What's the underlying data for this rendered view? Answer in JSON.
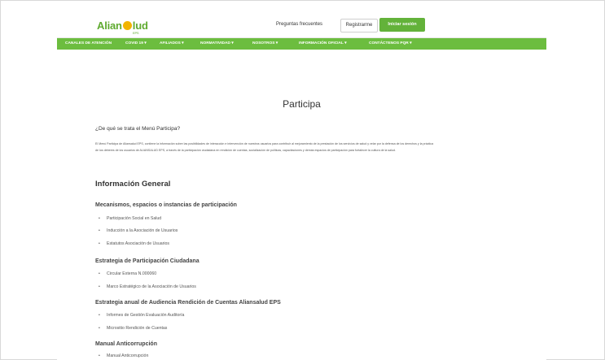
{
  "header": {
    "logo_text_a": "Alian",
    "logo_text_b": "lud",
    "logo_small": "EPS",
    "faq_link": "Preguntas frecuentes",
    "register_button": "Registrarme",
    "login_button": "Iniciar sesión"
  },
  "nav": {
    "items": [
      "CANALES DE ATENCIÓN",
      "COVID 19 ▾",
      "AFILIADOS ▾",
      "NORMATIVIDAD ▾",
      "NOSOTROS ▾",
      "INFORMACIÓN OFICIAL ▾",
      "CONTÁCTENOS PQR ▾"
    ]
  },
  "main": {
    "title": "Participa",
    "question": "¿De qué se trata el Menú Participa?",
    "paragraph": "El Menú Participa de Aliansalud EPS, contiene la información sobre las posibilidades de interacción e intervención de nuestros usuarios para contribuir al mejoramiento de la prestación de los servicios de salud y velar por la defensa de los derechos y la práctica de los deberes de los usuarios de ALIANSALUD EPS, a través de la participación ciudadana en rendición de cuentas, socialización de políticas, capacitaciones y demás espacios de participación para fortalecer la cultura de la salud.",
    "general_heading": "Información General",
    "sections": [
      {
        "heading": "Mecanismos, espacios o instancias de participación",
        "items": [
          "Participación Social en Salud",
          "Inducción a la Asociación de Usuarios",
          "Estatutos Asociación de Usuarios"
        ]
      },
      {
        "heading": "Estrategia de Participación Ciudadana",
        "items": [
          "Circular Externa N.000060",
          "Marco Estratégico de la Asociación de Usuarios"
        ]
      },
      {
        "heading": "Estrategia anual de Audiencia Rendición de Cuentas Aliansalud EPS",
        "items": [
          "Informes de Gestión Evaluación Auditoría",
          "Micrositio Rendición de Cuentas"
        ]
      },
      {
        "heading": "Manual Anticorrupción",
        "items": [
          "Manual Anticorrupción"
        ]
      }
    ]
  },
  "colors": {
    "brand_green": "#6cbd3f",
    "button_green": "#63b23a",
    "logo_sun": "#f2b400"
  }
}
